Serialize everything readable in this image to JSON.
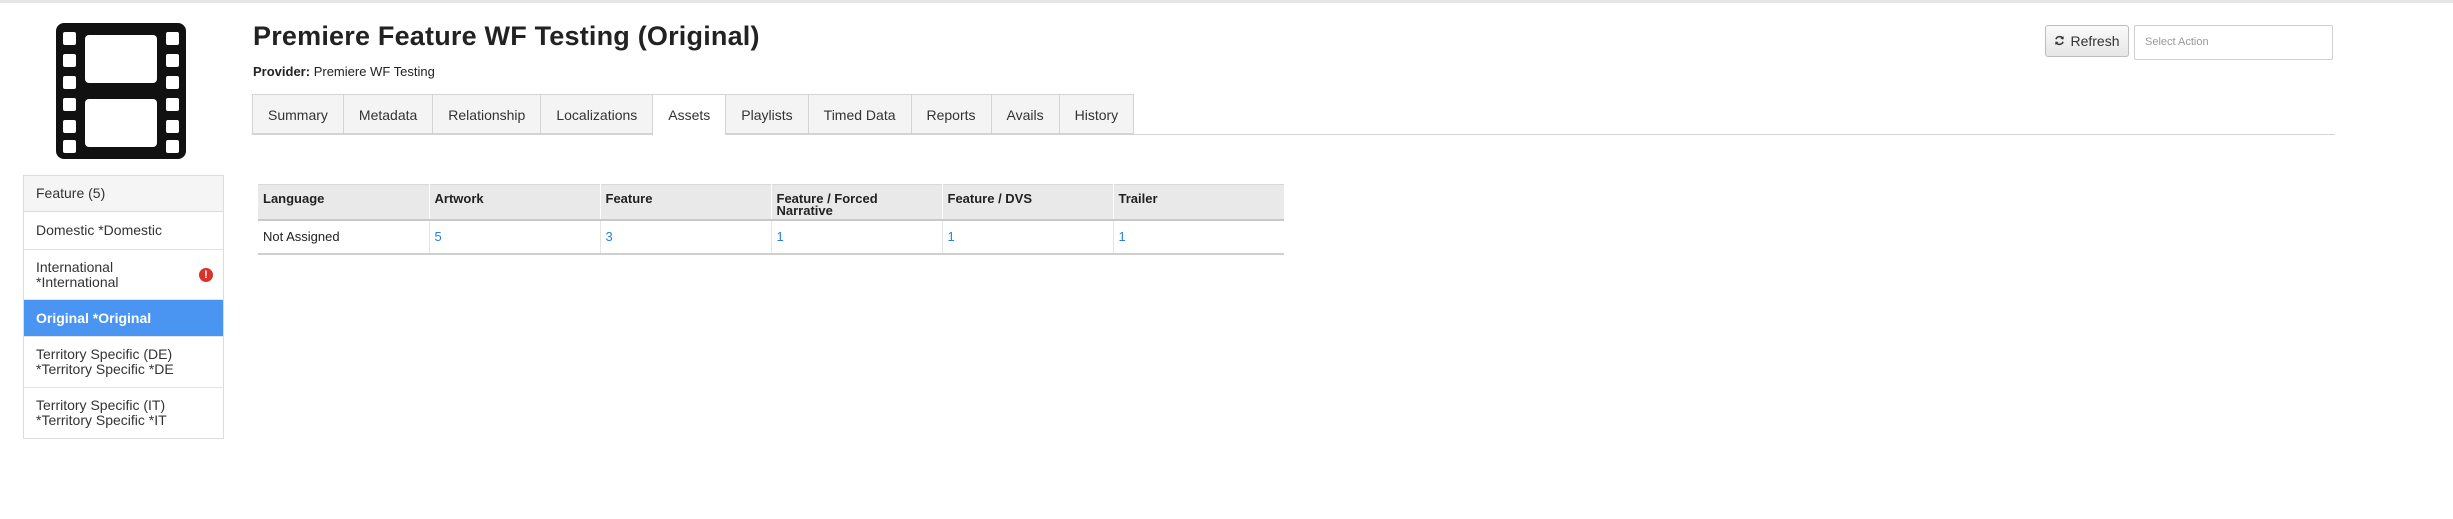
{
  "header": {
    "title": "Premiere Feature WF Testing (Original)",
    "provider_label": "Provider:",
    "provider_value": "Premiere WF Testing",
    "refresh_label": "Refresh",
    "select_action_placeholder": "Select Action"
  },
  "poster": {
    "icon": "film-strip-icon"
  },
  "sidebar": {
    "heading": "Feature (5)",
    "items": [
      {
        "label": "Domestic *Domestic",
        "warning": false
      },
      {
        "label": "International\n*International",
        "warning": true
      },
      {
        "label": "Original *Original",
        "warning": false,
        "active": true
      },
      {
        "label": "Territory Specific (DE)\n*Territory Specific *DE",
        "warning": false
      },
      {
        "label": "Territory Specific (IT)\n*Territory Specific *IT",
        "warning": false
      }
    ]
  },
  "tabs": [
    "Summary",
    "Metadata",
    "Relationship",
    "Localizations",
    "Assets",
    "Playlists",
    "Timed Data",
    "Reports",
    "Avails",
    "History"
  ],
  "active_tab": "Assets",
  "assets_table": {
    "columns": [
      "Language",
      "Artwork",
      "Feature",
      "Feature / Forced Narrative",
      "Feature / DVS",
      "Trailer"
    ],
    "rows": [
      {
        "language": "Not Assigned",
        "artwork": "5",
        "feature": "3",
        "forced_narrative": "1",
        "dvs": "1",
        "trailer": "1"
      }
    ]
  },
  "colors": {
    "accent": "#4a95f2",
    "link": "#2b80d6",
    "warning": "#d9342b"
  }
}
